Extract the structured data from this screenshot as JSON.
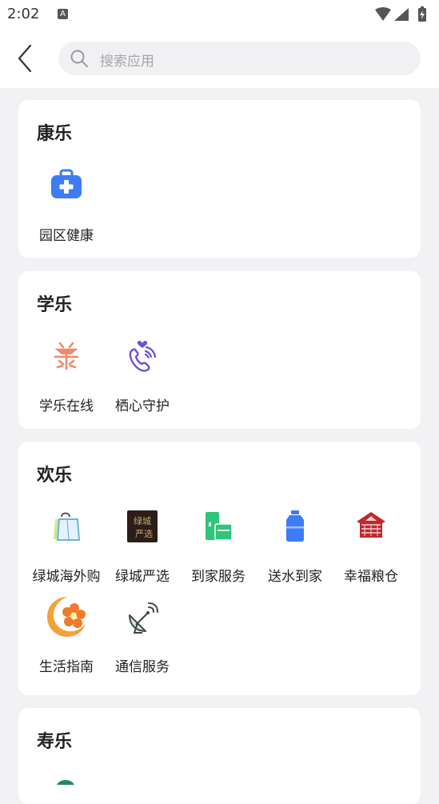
{
  "status_bar": {
    "time": "2:02",
    "notification_badge": "A"
  },
  "search": {
    "placeholder": "搜索应用"
  },
  "sections": [
    {
      "title": "康乐",
      "apps": [
        {
          "label": "园区健康",
          "icon": "medical-kit-icon"
        }
      ]
    },
    {
      "title": "学乐",
      "apps": [
        {
          "label": "学乐在线",
          "icon": "xuele-logo-icon"
        },
        {
          "label": "栖心守护",
          "icon": "heart-phone-icon"
        }
      ]
    },
    {
      "title": "欢乐",
      "apps": [
        {
          "label": "绿城海外购",
          "icon": "shopping-bag-icon"
        },
        {
          "label": "绿城严选",
          "icon": "greentown-select-icon",
          "icon_text": "绿城\n严选"
        },
        {
          "label": "到家服务",
          "icon": "home-service-icon"
        },
        {
          "label": "送水到家",
          "icon": "water-bottle-icon"
        },
        {
          "label": "幸福粮仓",
          "icon": "granary-icon"
        },
        {
          "label": "生活指南",
          "icon": "life-guide-icon"
        },
        {
          "label": "通信服务",
          "icon": "satellite-dish-icon"
        }
      ]
    },
    {
      "title": "寿乐",
      "apps": []
    }
  ],
  "colors": {
    "background": "#f2f2f4",
    "card": "#ffffff",
    "blue": "#3d7cf4",
    "green": "#2fc57a",
    "purple": "#6c4fd6",
    "orange": "#f5a03a",
    "red": "#c0282d"
  }
}
